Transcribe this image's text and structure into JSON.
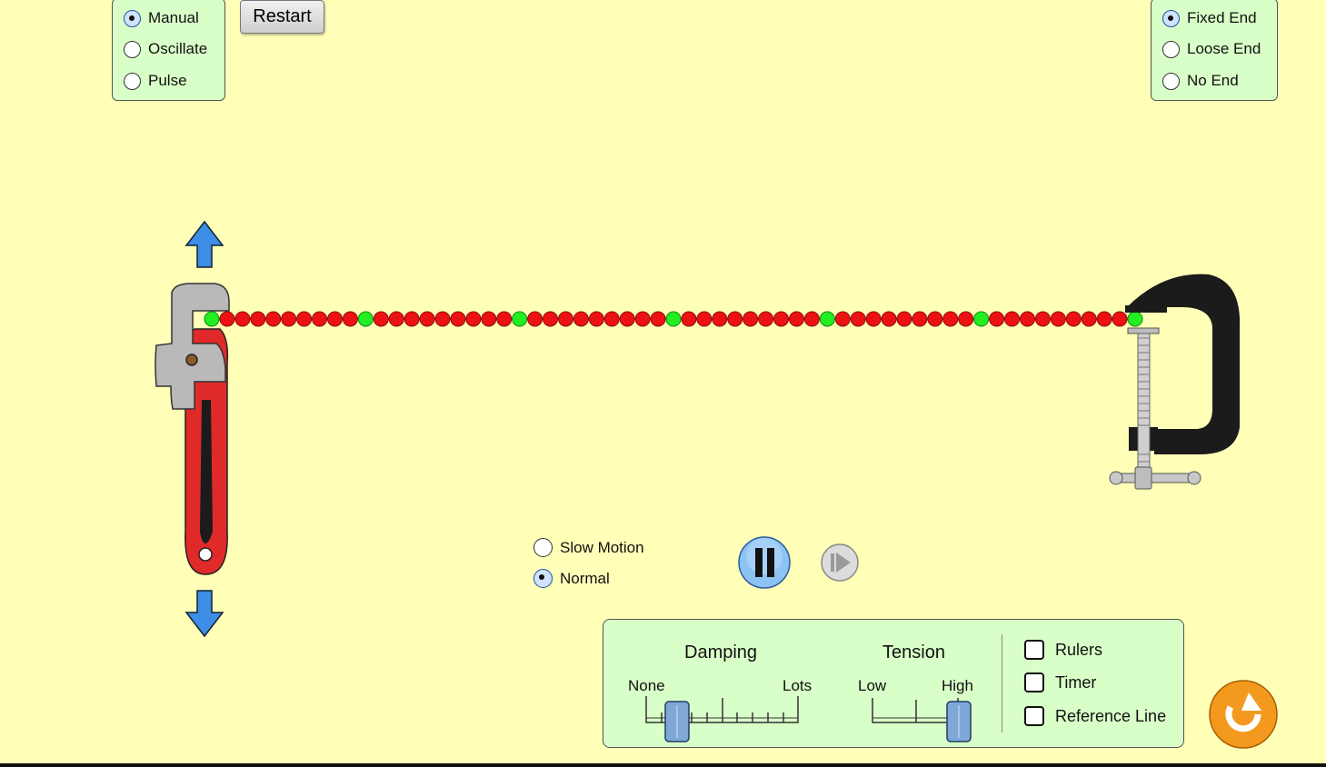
{
  "mode_options": [
    {
      "label": "Manual",
      "selected": true
    },
    {
      "label": "Oscillate",
      "selected": false
    },
    {
      "label": "Pulse",
      "selected": false
    }
  ],
  "restart_label": "Restart",
  "end_options": [
    {
      "label": "Fixed End",
      "selected": true
    },
    {
      "label": "Loose End",
      "selected": false
    },
    {
      "label": "No End",
      "selected": false
    }
  ],
  "speed_options": [
    {
      "label": "Slow Motion",
      "selected": false
    },
    {
      "label": "Normal",
      "selected": true
    }
  ],
  "controls": {
    "damping": {
      "title": "Damping",
      "min_label": "None",
      "max_label": "Lots",
      "value": 0.2
    },
    "tension": {
      "title": "Tension",
      "min_label": "Low",
      "max_label": "High",
      "value": 1.0
    },
    "checkboxes": [
      {
        "label": "Rulers",
        "checked": false
      },
      {
        "label": "Timer",
        "checked": false
      },
      {
        "label": "Reference Line",
        "checked": false
      }
    ]
  },
  "string": {
    "bead_count": 61,
    "green_every": 10
  },
  "colors": {
    "background": "#ffffb7",
    "panel": "#d9ffc8",
    "bead_red": "#ee1111",
    "bead_green": "#22ee22",
    "arrow_blue": "#3d8ee6",
    "reset_orange": "#f39a1e",
    "wrench_red": "#e02a2a",
    "clamp_black": "#1b1b1b"
  }
}
